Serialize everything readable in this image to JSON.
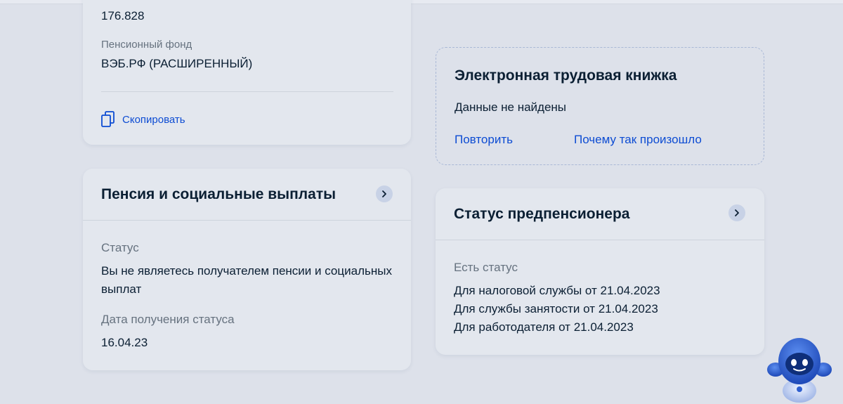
{
  "left_top_card": {
    "number_value": "176.828",
    "fund_label": "Пенсионный фонд",
    "fund_value": "ВЭБ.РФ (РАСШИРЕННЫЙ)",
    "copy_label": "Скопировать"
  },
  "pension_card": {
    "title": "Пенсия и социальные выплаты",
    "status_label": "Статус",
    "status_value": "Вы не являетесь получателем пенсии и социальных выплат",
    "date_label": "Дата получения статуса",
    "date_value": "16.04.23"
  },
  "work_book_card": {
    "title": "Электронная трудовая книжка",
    "message": "Данные не найдены",
    "retry_link": "Повторить",
    "why_link": "Почему так произошло"
  },
  "prepension_card": {
    "title": "Статус предпенсионера",
    "status_label": "Есть статус",
    "lines": [
      "Для налоговой службы от 21.04.2023",
      "Для службы занятости от 21.04.2023",
      "Для работодателя от 21.04.2023"
    ]
  },
  "colors": {
    "accent": "#0d4cd3",
    "text": "#0b1f33",
    "muted": "#66727f",
    "background": "#dde1ea"
  },
  "icons": [
    "copy-icon",
    "chevron-right-icon",
    "robot-assistant-icon"
  ]
}
